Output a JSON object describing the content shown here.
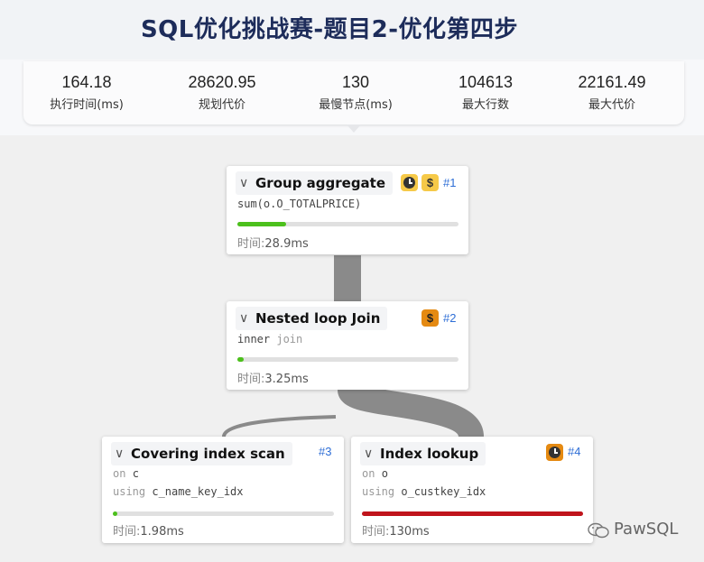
{
  "title": "SQL优化挑战赛-题目2-优化第四步",
  "stats": [
    {
      "value": "164.18",
      "label": "执行时间(ms)"
    },
    {
      "value": "28620.95",
      "label": "规划代价"
    },
    {
      "value": "130",
      "label": "最慢节点(ms)"
    },
    {
      "value": "104613",
      "label": "最大行数"
    },
    {
      "value": "22161.49",
      "label": "最大代价"
    }
  ],
  "nodes": {
    "n1": {
      "name": "Group aggregate",
      "id": "#1",
      "detail": "sum(o.O_TOTALPRICE)",
      "time_label": "时间:",
      "time": "28.9ms",
      "progress": 0.22,
      "progress_color": "#4cc01c",
      "badges": [
        "clock-icon",
        "dollar-icon"
      ]
    },
    "n2": {
      "name": "Nested loop Join",
      "id": "#2",
      "detail_kw": "inner",
      "detail_val": "join",
      "time_label": "时间:",
      "time": "3.25ms",
      "progress": 0.03,
      "progress_color": "#4cc01c",
      "badges": [
        "dollar-icon"
      ]
    },
    "n3": {
      "name": "Covering index scan",
      "id": "#3",
      "line1_kw": "on",
      "line1_val": "c",
      "line2_kw": "using",
      "line2_val": "c_name_key_idx",
      "time_label": "时间:",
      "time": "1.98ms",
      "progress": 0.02,
      "progress_color": "#4cc01c",
      "badges": []
    },
    "n4": {
      "name": "Index lookup",
      "id": "#4",
      "line1_kw": "on",
      "line1_val": "o",
      "line2_kw": "using",
      "line2_val": "o_custkey_idx",
      "time_label": "时间:",
      "time": "130ms",
      "progress": 1.0,
      "progress_color": "#c0141c",
      "badges": [
        "clock-icon"
      ]
    }
  },
  "watermark": "PawSQL",
  "colors": {
    "title": "#1d2c5a",
    "link": "#8a8a8a",
    "node_id": "#2e6ed6"
  }
}
